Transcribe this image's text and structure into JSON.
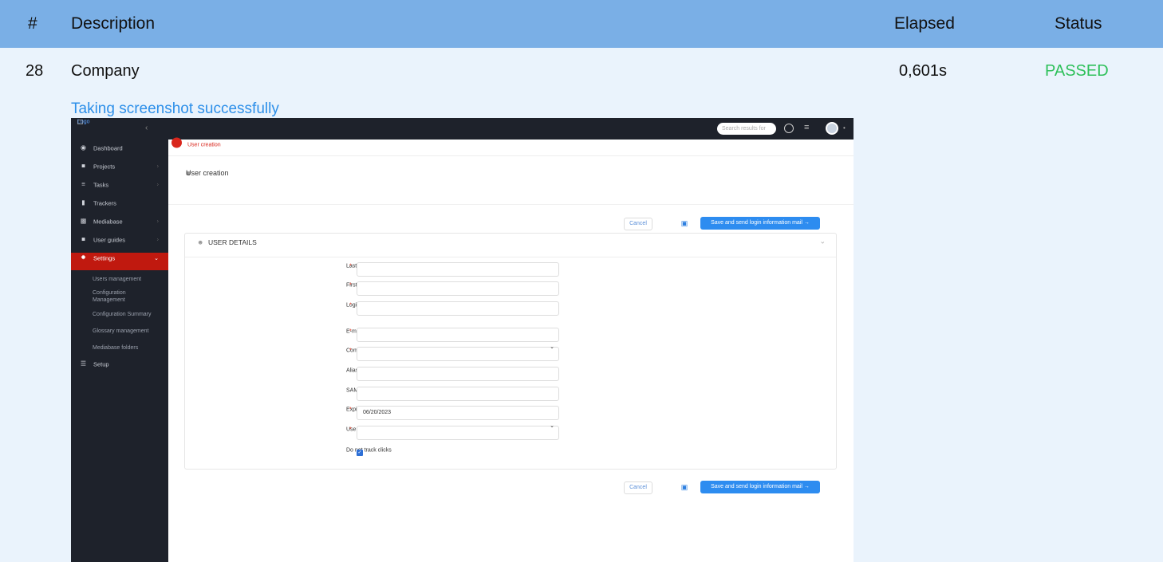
{
  "report": {
    "headers": {
      "num": "#",
      "description": "Description",
      "elapsed": "Elapsed",
      "status": "Status"
    },
    "row": {
      "num": "28",
      "description": "Company",
      "elapsed": "0,601s",
      "status": "PASSED"
    },
    "caption": "Taking screenshot successfully",
    "status_color": "#2ec05a",
    "header_color": "#7aafe6"
  },
  "app": {
    "logo_alt": "Logo",
    "search_placeholder": "Search results for",
    "sidebar": {
      "items": [
        {
          "label": "Dashboard",
          "icon": "palette-icon"
        },
        {
          "label": "Projects",
          "icon": "folder-open-icon"
        },
        {
          "label": "Tasks",
          "icon": "list-icon"
        },
        {
          "label": "Trackers",
          "icon": "clipboard-icon"
        },
        {
          "label": "Mediabase",
          "icon": "image-icon"
        },
        {
          "label": "User guides",
          "icon": "folder-icon"
        },
        {
          "label": "Settings",
          "icon": "gear-icon"
        },
        {
          "label": "Setup",
          "icon": "database-icon"
        }
      ],
      "settings_sub": [
        "Users management",
        "Configuration Management",
        "Configuration Summary",
        "Glossary management",
        "Mediabase folders"
      ]
    },
    "breadcrumb": "User creation",
    "page_title": "User creation",
    "buttons": {
      "cancel": "Cancel",
      "save_send": "Save and send login information mail →"
    },
    "panel_title": "USER DETAILS",
    "fields": [
      {
        "label": "Last name",
        "required": "*",
        "value": ""
      },
      {
        "label": "First name",
        "required": "*",
        "value": ""
      },
      {
        "label": "Login",
        "required": "*",
        "value": ""
      },
      {
        "label": "E-mail",
        "required": "*",
        "value": ""
      },
      {
        "label": "Company",
        "required": "*",
        "value": ""
      },
      {
        "label": "Alias",
        "required": "",
        "value": ""
      },
      {
        "label": "SAML user id",
        "required": "",
        "value": ""
      },
      {
        "label": "Expiration date",
        "required": "*",
        "value": "06/20/2023"
      },
      {
        "label": "User role",
        "required": "*",
        "value": ""
      },
      {
        "label": "Do not track clicks",
        "required": "",
        "value": ""
      }
    ]
  }
}
